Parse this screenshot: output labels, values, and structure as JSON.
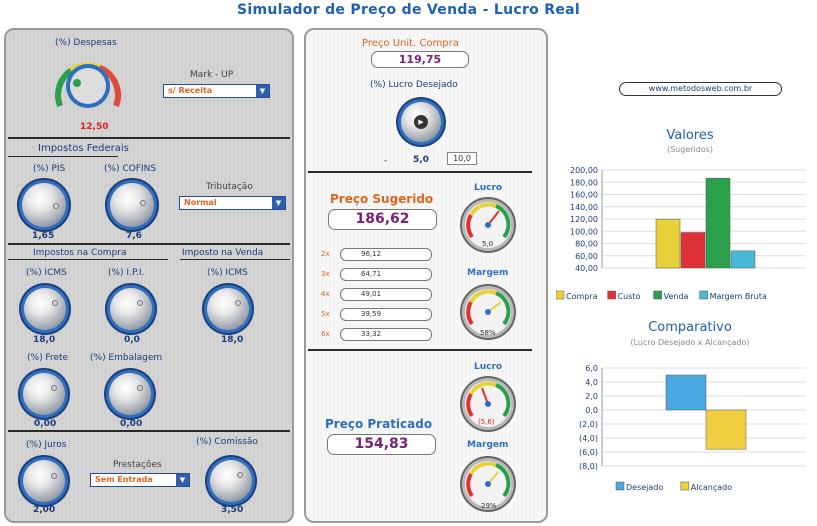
{
  "title": "Simulador de Preço de Venda - Lucro Real",
  "left": {
    "despesas_label": "(%) Despesas",
    "despesas_value": "12,50",
    "markup_label": "Mark - UP",
    "markup_select": "s/ Receita",
    "impostos_federais": "Impostos Federais",
    "pis_label": "(%) PIS",
    "pis_value": "1,65",
    "cofins_label": "(%) COFINS",
    "cofins_value": "7,6",
    "tributacao_label": "Tributação",
    "tributacao_select": "Normal",
    "impostos_compra": "Impostos na Compra",
    "imposto_venda": "Imposto na Venda",
    "icms_compra_label": "(%) ICMS",
    "icms_compra_value": "18,0",
    "ipi_label": "(%) I.P.I.",
    "ipi_value": "0,0",
    "icms_venda_label": "(%) ICMS",
    "icms_venda_value": "18,0",
    "frete_label": "(%) Frete",
    "frete_value": "0,00",
    "embalagem_label": "(%) Embalagem",
    "embalagem_value": "0,00",
    "juros_label": "(%) Juros",
    "juros_value": "2,00",
    "prestacoes_label": "Prestações",
    "prestacoes_select": "Sem Entrada",
    "comissao_label": "(%) Comissão",
    "comissao_value": "3,50"
  },
  "mid": {
    "preco_compra_label": "Preço Unit. Compra",
    "preco_compra_value": "119,75",
    "lucro_desejado_label": "(%) Lucro Desejado",
    "lucro_desejado_dash": "-",
    "lucro_desejado_value": "5,0",
    "lucro_desejado_input": "10,0",
    "preco_sugerido_label": "Preço Sugerido",
    "preco_sugerido_value": "186,62",
    "parcelas": [
      {
        "n": "2x",
        "v": "96,12"
      },
      {
        "n": "3x",
        "v": "64,71"
      },
      {
        "n": "4x",
        "v": "49,01"
      },
      {
        "n": "5x",
        "v": "39,59"
      },
      {
        "n": "6x",
        "v": "33,32"
      }
    ],
    "lucro_label_1": "Lucro",
    "gauge_lucro_1": "5,0",
    "margem_label_1": "Margem",
    "gauge_margem_1": "58%",
    "preco_praticado_label": "Preço Praticado",
    "preco_praticado_value": "154,83",
    "lucro_label_2": "Lucro",
    "gauge_lucro_2": "(5,6)",
    "margem_label_2": "Margem",
    "gauge_margem_2": "29%"
  },
  "right": {
    "link": "www.metodosweb.com.br"
  },
  "chart_data": [
    {
      "type": "bar",
      "title": "Valores",
      "subtitle": "(Sugeridos)",
      "ylim": [
        40,
        200
      ],
      "ticks": [
        "200,00",
        "180,00",
        "160,00",
        "140,00",
        "120,00",
        "100,00",
        "80,00",
        "60,00",
        "40,00"
      ],
      "series": [
        {
          "name": "Compra",
          "value": 119.75,
          "color": "#e8d23a"
        },
        {
          "name": "Custo",
          "value": 98,
          "color": "#e0303a"
        },
        {
          "name": "Venda",
          "value": 186.62,
          "color": "#2aa04a"
        },
        {
          "name": "Margem Bruta",
          "value": 68,
          "color": "#49b8d8"
        }
      ],
      "legend": "bottom"
    },
    {
      "type": "bar",
      "title": "Comparativo",
      "subtitle": "(Lucro Desejado x Alcançado)",
      "ylim": [
        -8,
        6
      ],
      "ticks": [
        "6,0",
        "4,0",
        "2,0",
        "0,0",
        "(2,0)",
        "(4,0)",
        "(6,0)",
        "(8,0)"
      ],
      "series": [
        {
          "name": "Desejado",
          "value": 5.0,
          "color": "#49a8e0"
        },
        {
          "name": "Alcançado",
          "value": -5.6,
          "color": "#f0d040"
        }
      ],
      "legend": "bottom"
    }
  ]
}
